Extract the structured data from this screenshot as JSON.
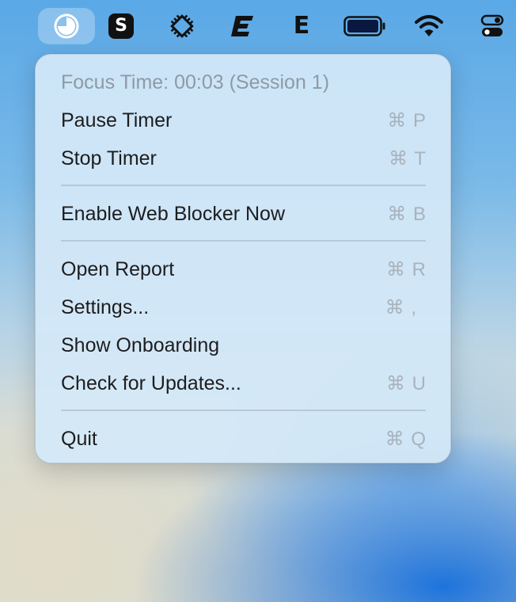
{
  "menubar": {
    "icons": [
      {
        "name": "focus-timer-app-icon",
        "active": true
      },
      {
        "name": "s-app-icon"
      },
      {
        "name": "diagonal-chip-app-icon"
      },
      {
        "name": "e-italic-app-icon"
      },
      {
        "name": "e-app-icon",
        "letter": "E"
      },
      {
        "name": "battery-icon"
      },
      {
        "name": "wifi-icon"
      },
      {
        "name": "control-center-icon"
      }
    ],
    "s_letter": "S",
    "e_letter": "E"
  },
  "menu": {
    "status": "Focus Time: 00:03 (Session 1)",
    "items": [
      {
        "label": "Pause Timer",
        "shortcut": "⌘ P"
      },
      {
        "label": "Stop Timer",
        "shortcut": "⌘ T"
      },
      {
        "label": "Enable Web Blocker Now",
        "shortcut": "⌘ B"
      },
      {
        "label": "Open Report",
        "shortcut": "⌘ R"
      },
      {
        "label": "Settings...",
        "shortcut": "⌘ ,"
      },
      {
        "label": "Show Onboarding",
        "shortcut": ""
      },
      {
        "label": "Check for Updates...",
        "shortcut": "⌘ U"
      },
      {
        "label": "Quit",
        "shortcut": "⌘ Q"
      }
    ]
  },
  "colors": {
    "menu_text": "#1d1d1f",
    "disabled_text": "#8e9aa6",
    "shortcut_text": "#a8b3bd"
  }
}
